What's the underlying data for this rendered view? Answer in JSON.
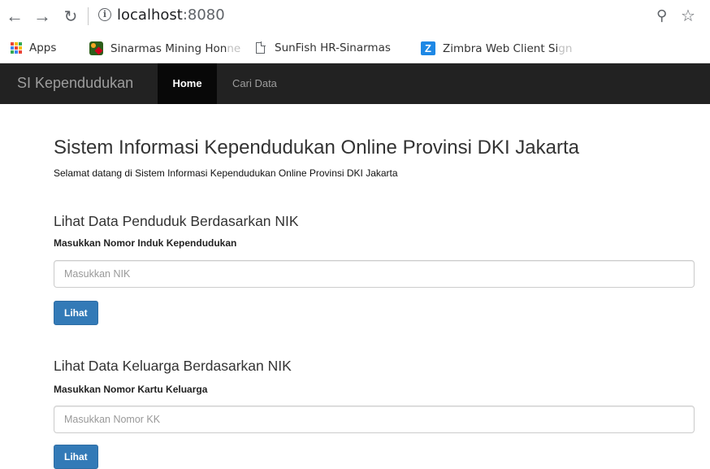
{
  "browser": {
    "url_host": "localhost",
    "url_port": ":8080",
    "bookmarks": [
      {
        "label": "Apps",
        "faded": ""
      },
      {
        "label": "Sinarmas Mining Hon",
        "faded": "ne"
      },
      {
        "label": "SunFish HR-Sinarmas",
        "faded": ""
      },
      {
        "label": "Zimbra Web Client Si",
        "faded": "gn"
      }
    ],
    "colors": {
      "apps_grid": [
        "#ea4335",
        "#fbbc05",
        "#34a853",
        "#4285f4"
      ]
    }
  },
  "navbar": {
    "brand": "SI Kependudukan",
    "items": [
      {
        "label": "Home",
        "active": true
      },
      {
        "label": "Cari Data",
        "active": false
      }
    ]
  },
  "main": {
    "title": "Sistem Informasi Kependudukan Online Provinsi DKI Jakarta",
    "subtitle": "Selamat datang di Sistem Informasi Kependudukan Online Provinsi DKI Jakarta",
    "sections": [
      {
        "heading": "Lihat Data Penduduk Berdasarkan NIK",
        "label": "Masukkan Nomor Induk Kependudukan",
        "placeholder": "Masukkan NIK",
        "button": "Lihat"
      },
      {
        "heading": "Lihat Data Keluarga Berdasarkan NIK",
        "label": "Masukkan Nomor Kartu Keluarga",
        "placeholder": "Masukkan Nomor KK",
        "button": "Lihat"
      }
    ]
  },
  "colors": {
    "navbar_bg": "#222222",
    "navbar_active": "#080808",
    "primary_button": "#337ab7"
  }
}
